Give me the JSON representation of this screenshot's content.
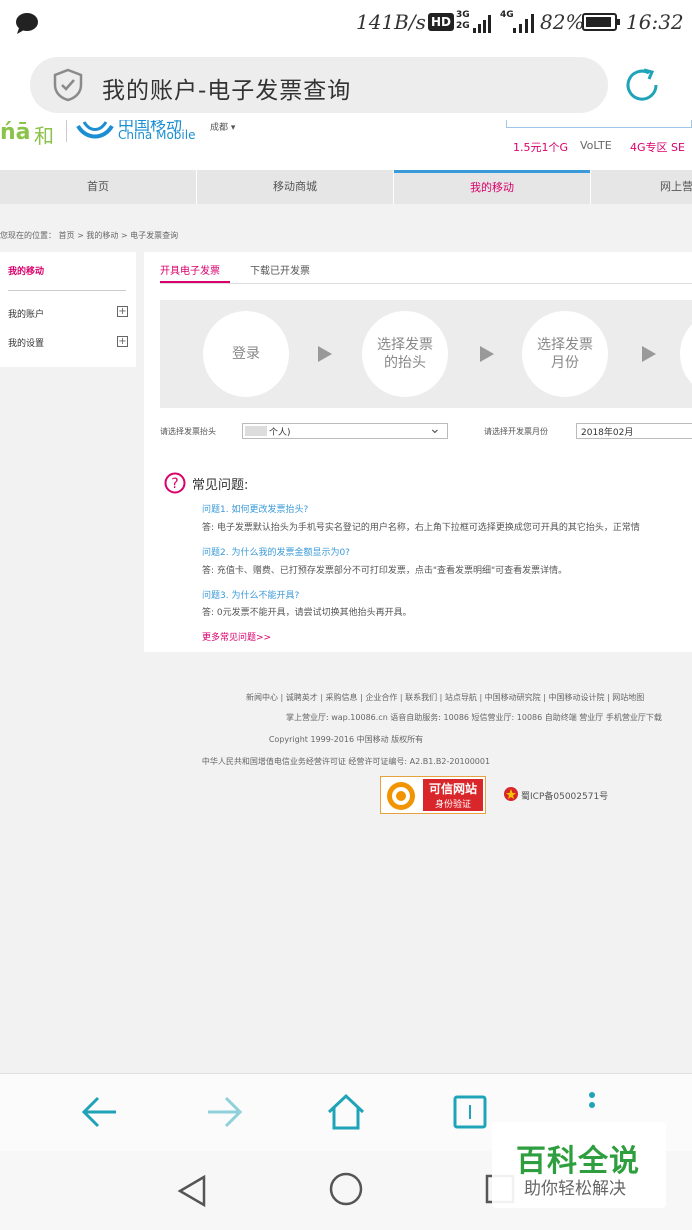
{
  "status_bar": {
    "speed": "141B/s",
    "hd": "HD",
    "net3g": "3G",
    "net2g": "2G",
    "net4g": "4G",
    "battery": "82%",
    "time": "16:32"
  },
  "browser": {
    "title": "我的账户-电子发票查询"
  },
  "header": {
    "brand_he": "和",
    "brand_cn": "中国移动",
    "brand_en": "China Mobile",
    "city": "成都",
    "promos": [
      "1.5元1个G",
      "VoLTE",
      "4G专区 SE"
    ]
  },
  "nav": {
    "items": [
      "首页",
      "移动商城",
      "我的移动",
      "网上营"
    ]
  },
  "breadcrumb": "您现在的位置： 首页 > 我的移动 > 电子发票查询",
  "sidebar": {
    "title": "我的移动",
    "items": [
      "我的账户",
      "我的设置"
    ]
  },
  "tabs": [
    "开具电子发票",
    "下载已开发票"
  ],
  "steps": {
    "step1": "登录",
    "step2_l1": "选择发票",
    "step2_l2": "的抬头",
    "step3_l1": "选择发票",
    "step3_l2": "月份"
  },
  "form": {
    "header_label": "请选择发票抬头",
    "header_value": "个人)",
    "month_label": "请选择开发票月份",
    "month_value": "2018年02月"
  },
  "faq": {
    "title": "常见问题:",
    "q1": "问题1. 如何更改发票抬头?",
    "a1": "答: 电子发票默认抬头为手机号实名登记的用户名称，右上角下拉框可选择更换成您可开具的其它抬头，正常情",
    "q2": "问题2. 为什么我的发票金额显示为0?",
    "a2": "答: 充值卡、赠费、已打预存发票部分不可打印发票，点击\"查看发票明细\"可查看发票详情。",
    "q3": "问题3. 为什么不能开具?",
    "a3": "答: 0元发票不能开具，请尝试切换其他抬头再开具。",
    "more": "更多常见问题>>"
  },
  "footer": {
    "links": "新闻中心 | 诚聘英才 | 采购信息 | 企业合作 | 联系我们 | 站点导航 | 中国移动研究院 | 中国移动设计院 | 网站地图",
    "line2": "掌上营业厅: wap.10086.cn 语音自助服务: 10086 短信营业厅: 10086 自助终端 营业厅 手机营业厅下载",
    "copyright": "Copyright 1999-2016 中国移动 版权所有",
    "license": "中华人民共和国增值电信业务经营许可证 经营许可证编号: A2.B1.B2-20100001",
    "badge_l1": "可信网站",
    "badge_l2": "身份验证",
    "icp": "蜀ICP备05002571号"
  },
  "watermark": {
    "title": "百科全说",
    "subtitle": "助你轻松解决"
  },
  "colors": {
    "brand_pink": "#d9006c",
    "teal": "#1fa3b8",
    "link_blue": "#3a9ad9"
  }
}
